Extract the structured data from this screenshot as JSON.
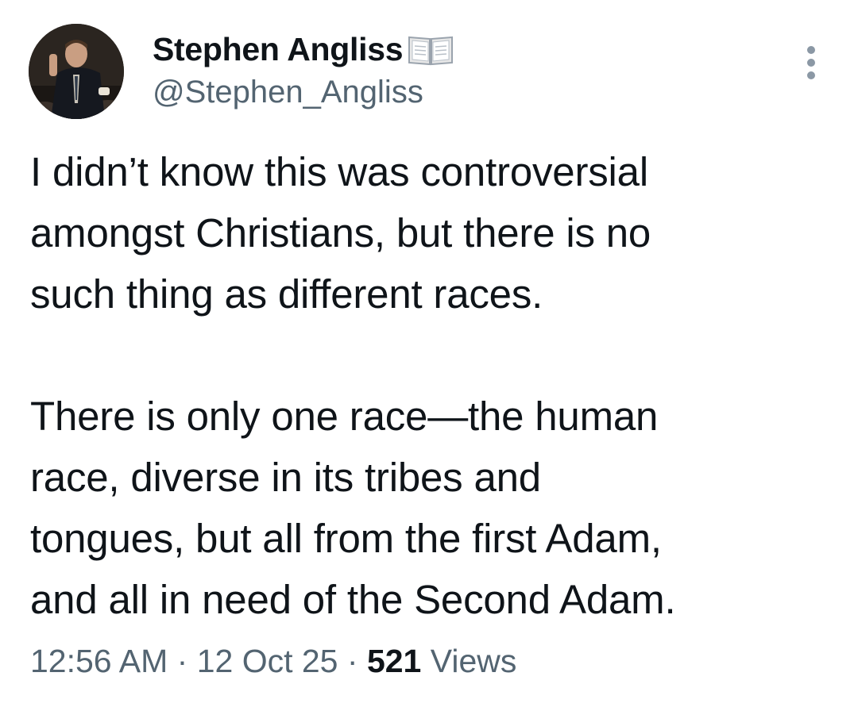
{
  "author": {
    "display_name": "Stephen Angliss",
    "name_emoji": "open-book-icon",
    "handle": "@Stephen_Angliss"
  },
  "tweet": {
    "paragraph1": [
      "I didn’t know this was controversial",
      "amongst Christians, but there is no",
      "such thing as different races."
    ],
    "paragraph2": [
      "There is only one race—the human",
      "race, diverse in its tribes and",
      "tongues, but all from the first Adam,",
      "and all in need of the Second Adam."
    ]
  },
  "meta": {
    "time": "12:56 AM",
    "separator": "·",
    "date": "12 Oct 25",
    "views_count": "521",
    "views_label": "Views"
  },
  "colors": {
    "text_primary": "#0f1419",
    "text_secondary": "#536471",
    "background": "#ffffff"
  }
}
